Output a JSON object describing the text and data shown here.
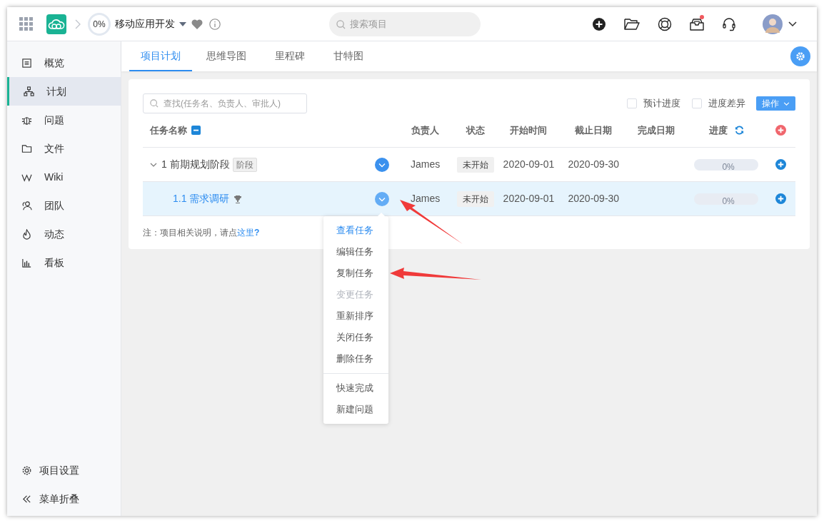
{
  "header": {
    "project_progress": "0%",
    "project_name": "移动应用开发",
    "search": {
      "placeholder": "搜索项目"
    },
    "notification_dot": true
  },
  "sidebar": {
    "items": [
      {
        "label": "概览",
        "selected": false
      },
      {
        "label": "计划",
        "selected": true
      },
      {
        "label": "问题",
        "selected": false
      },
      {
        "label": "文件",
        "selected": false
      },
      {
        "label": "Wiki",
        "selected": false
      },
      {
        "label": "团队",
        "selected": false
      },
      {
        "label": "动态",
        "selected": false
      },
      {
        "label": "看板",
        "selected": false
      }
    ],
    "footer": [
      {
        "label": "项目设置"
      },
      {
        "label": "菜单折叠"
      }
    ]
  },
  "tabs": [
    {
      "label": "项目计划",
      "selected": true
    },
    {
      "label": "思维导图",
      "selected": false
    },
    {
      "label": "里程碑",
      "selected": false
    },
    {
      "label": "甘特图",
      "selected": false
    }
  ],
  "toolbar": {
    "search": {
      "placeholder": "查找(任务名、负责人、审批人)"
    },
    "checkboxes": [
      {
        "label": "预计进度",
        "checked": false
      },
      {
        "label": "进度差异",
        "checked": false
      }
    ],
    "action_button": "操作"
  },
  "table": {
    "columns": [
      "任务名称",
      "负责人",
      "状态",
      "开始时间",
      "截止日期",
      "完成日期",
      "进度"
    ],
    "rows": [
      {
        "number": "1",
        "name": "前期规划阶段",
        "tag": "阶段",
        "expanded": true,
        "selected": false,
        "trophy": false,
        "owner": "James",
        "status": "未开始",
        "start": "2020-09-01",
        "due": "2020-09-30",
        "progress": "0%",
        "children": [
          {
            "number": "1.1",
            "name": "需求调研",
            "selected": true,
            "trophy": true,
            "owner": "James",
            "status": "未开始",
            "start": "2020-09-01",
            "due": "2020-09-30",
            "progress": "0%"
          }
        ]
      }
    ]
  },
  "note": {
    "text": "注：项目相关说明，请点",
    "link": "这里",
    "mark": "?"
  },
  "context_menu": {
    "groups": [
      [
        {
          "label": "查看任务",
          "highlighted": true,
          "disabled": false
        },
        {
          "label": "编辑任务",
          "highlighted": false,
          "disabled": false
        },
        {
          "label": "复制任务",
          "highlighted": false,
          "disabled": false
        },
        {
          "label": "变更任务",
          "highlighted": false,
          "disabled": true
        },
        {
          "label": "重新排序",
          "highlighted": false,
          "disabled": false
        },
        {
          "label": "关闭任务",
          "highlighted": false,
          "disabled": false
        },
        {
          "label": "删除任务",
          "highlighted": false,
          "disabled": false
        }
      ],
      [
        {
          "label": "快速完成",
          "highlighted": false,
          "disabled": false
        },
        {
          "label": "新建问题",
          "highlighted": false,
          "disabled": false
        }
      ]
    ]
  }
}
